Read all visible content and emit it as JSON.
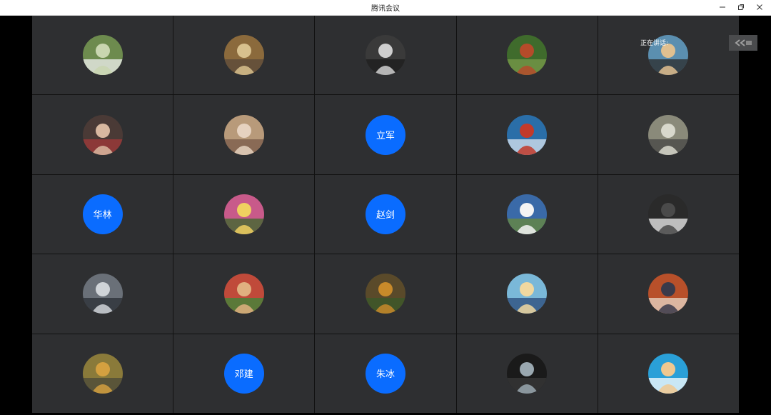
{
  "window": {
    "title": "腾讯会议"
  },
  "speaking": {
    "label": "正在讲话:"
  },
  "participants": [
    {
      "type": "photo",
      "icon": "person-field-photo"
    },
    {
      "type": "photo",
      "icon": "people-indoor-photo"
    },
    {
      "type": "photo",
      "icon": "man-suit-photo"
    },
    {
      "type": "photo",
      "icon": "garden-photo"
    },
    {
      "type": "photo",
      "icon": "pixel-avatar-photo"
    },
    {
      "type": "photo",
      "icon": "child-hat-photo"
    },
    {
      "type": "photo",
      "icon": "family-photo"
    },
    {
      "type": "initials",
      "text": "立军"
    },
    {
      "type": "photo",
      "icon": "jetski-photo"
    },
    {
      "type": "photo",
      "icon": "group-photo"
    },
    {
      "type": "initials",
      "text": "华林"
    },
    {
      "type": "photo",
      "icon": "flowers-photo"
    },
    {
      "type": "initials",
      "text": "赵剑"
    },
    {
      "type": "photo",
      "icon": "lighthouse-photo"
    },
    {
      "type": "photo",
      "icon": "man-presenting-photo"
    },
    {
      "type": "photo",
      "icon": "car-photo"
    },
    {
      "type": "photo",
      "icon": "selfie-photo"
    },
    {
      "type": "photo",
      "icon": "autumn-landscape-photo"
    },
    {
      "type": "photo",
      "icon": "cartoon-boy-photo"
    },
    {
      "type": "photo",
      "icon": "man-portrait-photo"
    },
    {
      "type": "photo",
      "icon": "tree-road-photo"
    },
    {
      "type": "initials",
      "text": "邓建"
    },
    {
      "type": "initials",
      "text": "朱冰"
    },
    {
      "type": "photo",
      "icon": "lake-sunset-photo"
    },
    {
      "type": "photo",
      "icon": "cartoon-glasses-photo"
    }
  ]
}
